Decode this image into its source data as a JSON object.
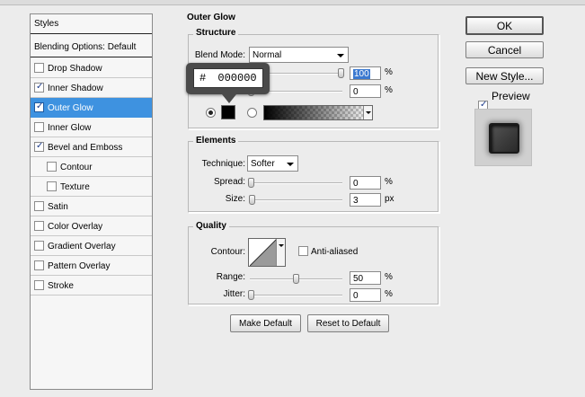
{
  "styles_panel": {
    "header": "Styles",
    "blending": "Blending Options: Default",
    "items": [
      {
        "label": "Drop Shadow",
        "checked": false,
        "sub": false,
        "selected": false
      },
      {
        "label": "Inner Shadow",
        "checked": true,
        "sub": false,
        "selected": false
      },
      {
        "label": "Outer Glow",
        "checked": true,
        "sub": false,
        "selected": true
      },
      {
        "label": "Inner Glow",
        "checked": false,
        "sub": false,
        "selected": false
      },
      {
        "label": "Bevel and Emboss",
        "checked": true,
        "sub": false,
        "selected": false
      },
      {
        "label": "Contour",
        "checked": false,
        "sub": true,
        "selected": false
      },
      {
        "label": "Texture",
        "checked": false,
        "sub": true,
        "selected": false
      },
      {
        "label": "Satin",
        "checked": false,
        "sub": false,
        "selected": false
      },
      {
        "label": "Color Overlay",
        "checked": false,
        "sub": false,
        "selected": false
      },
      {
        "label": "Gradient Overlay",
        "checked": false,
        "sub": false,
        "selected": false
      },
      {
        "label": "Pattern Overlay",
        "checked": false,
        "sub": false,
        "selected": false
      },
      {
        "label": "Stroke",
        "checked": false,
        "sub": false,
        "selected": false
      }
    ]
  },
  "outer_glow": {
    "title": "Outer Glow",
    "structure": {
      "title": "Structure",
      "blend_mode_label": "Blend Mode:",
      "blend_mode_value": "Normal",
      "opacity_value": "100",
      "opacity_level": 100,
      "noise_value": "0",
      "noise_level": 0,
      "percent": "%",
      "color_value": "000000",
      "hash": "#"
    },
    "elements": {
      "title": "Elements",
      "technique_label": "Technique:",
      "technique_value": "Softer",
      "spread_label": "Spread:",
      "spread_value": "0",
      "spread_unit": "%",
      "size_label": "Size:",
      "size_value": "3",
      "size_unit": "px"
    },
    "quality": {
      "title": "Quality",
      "contour_label": "Contour:",
      "anti_aliased_label": "Anti-aliased",
      "range_label": "Range:",
      "range_value": "50",
      "range_unit": "%",
      "jitter_label": "Jitter:",
      "jitter_value": "0",
      "jitter_unit": "%"
    },
    "make_default": "Make Default",
    "reset_default": "Reset to Default"
  },
  "buttons": {
    "ok": "OK",
    "cancel": "Cancel",
    "new_style": "New Style...",
    "preview_label": "Preview",
    "preview_checked": true
  },
  "colors": {
    "selection": "#3e92e0",
    "glow_color": "#000000"
  }
}
